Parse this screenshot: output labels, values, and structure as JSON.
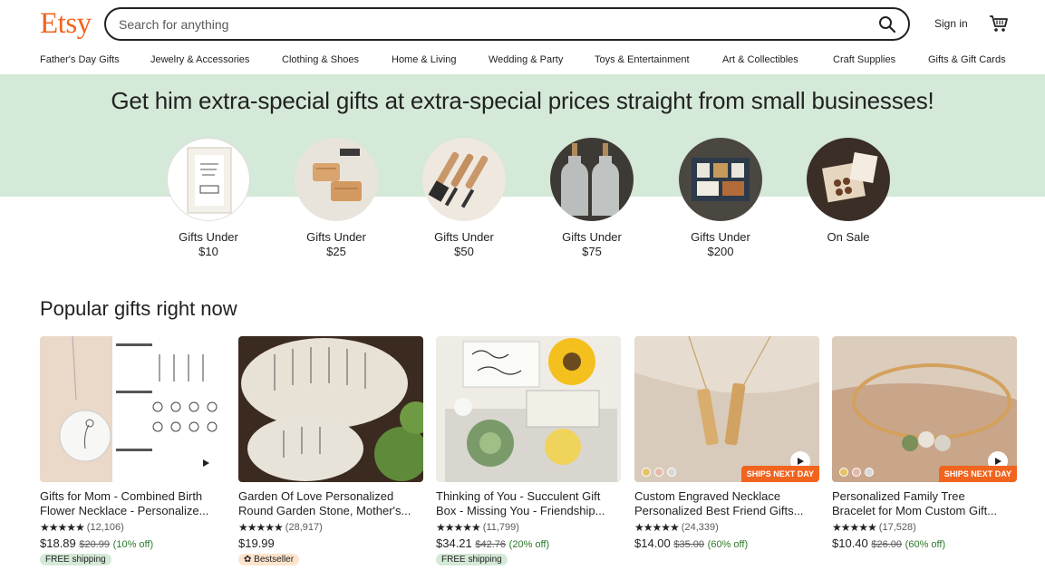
{
  "header": {
    "logo": "Etsy",
    "search_placeholder": "Search for anything",
    "signin": "Sign in"
  },
  "nav": [
    "Father's Day Gifts",
    "Jewelry & Accessories",
    "Clothing & Shoes",
    "Home & Living",
    "Wedding & Party",
    "Toys & Entertainment",
    "Art & Collectibles",
    "Craft Supplies",
    "Gifts & Gift Cards"
  ],
  "banner": {
    "title": "Get him extra-special gifts at extra-special prices straight from small businesses!",
    "categories": [
      {
        "line1": "Gifts Under",
        "line2": "$10"
      },
      {
        "line1": "Gifts Under",
        "line2": "$25"
      },
      {
        "line1": "Gifts Under",
        "line2": "$50"
      },
      {
        "line1": "Gifts Under",
        "line2": "$75"
      },
      {
        "line1": "Gifts Under",
        "line2": "$200"
      },
      {
        "line1": "On Sale",
        "line2": ""
      }
    ]
  },
  "popular": {
    "title": "Popular gifts right now",
    "items": [
      {
        "line1": "Gifts for Mom - Combined Birth",
        "line2": "Flower Necklace - Personalize...",
        "stars": "★★★★★",
        "reviews": "(12,106)",
        "price": "$18.89",
        "orig": "$20.99",
        "disc": "(10% off)",
        "badge": "FREE shipping"
      },
      {
        "line1": "Garden Of Love Personalized",
        "line2": "Round Garden Stone, Mother's...",
        "stars": "★★★★★",
        "reviews": "(28,917)",
        "price": "$19.99",
        "orig": "",
        "disc": "",
        "badge": "Bestseller"
      },
      {
        "line1": "Thinking of You - Succulent Gift",
        "line2": "Box - Missing You - Friendship...",
        "stars": "★★★★★",
        "reviews": "(11,799)",
        "price": "$34.21",
        "orig": "$42.76",
        "disc": "(20% off)",
        "badge": "FREE shipping"
      },
      {
        "line1": "Custom Engraved Necklace",
        "line2": "Personalized Best Friend Gifts...",
        "stars": "★★★★★",
        "reviews": "(24,339)",
        "price": "$14.00",
        "orig": "$35.00",
        "disc": "(60% off)",
        "badge": "",
        "ships": "SHIPS NEXT DAY"
      },
      {
        "line1": "Personalized Family Tree",
        "line2": "Bracelet for Mom Custom Gift...",
        "stars": "★★★★★",
        "reviews": "(17,528)",
        "price": "$10.40",
        "orig": "$26.00",
        "disc": "(60% off)",
        "badge": "",
        "ships": "SHIPS NEXT DAY"
      }
    ]
  },
  "colors": {
    "brand": "#f1641e",
    "banner_bg": "#d4e9d7",
    "discount": "#2a7a2a"
  },
  "icons": [
    "search-icon",
    "cart-icon",
    "play-icon",
    "bestseller-icon"
  ]
}
